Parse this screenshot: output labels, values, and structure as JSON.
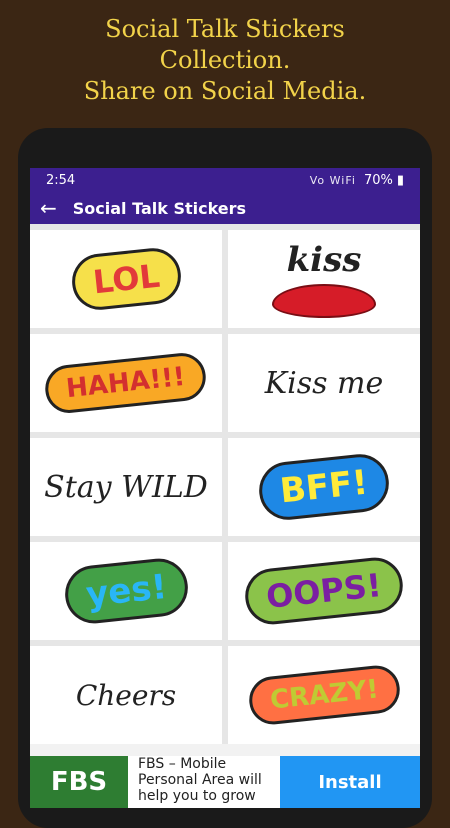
{
  "promo": {
    "line1": "Social Talk Stickers",
    "line2": "Collection.",
    "line3": "Share on Social Media."
  },
  "status": {
    "time": "2:54",
    "signal_icons": "Vo WiFi",
    "battery": "70%"
  },
  "appbar": {
    "title": "Social Talk Stickers"
  },
  "stickers": [
    {
      "text": "LOL"
    },
    {
      "text": "kiss"
    },
    {
      "text": "HAHA!!!"
    },
    {
      "text": "Kiss me"
    },
    {
      "text": "Stay WILD"
    },
    {
      "text": "BFF!"
    },
    {
      "text": "yes!"
    },
    {
      "text": "OOPS!"
    },
    {
      "text": "Cheers"
    },
    {
      "text": "CRAZY!"
    }
  ],
  "ad": {
    "logo": "FBS",
    "text": "FBS – Mobile Personal Area will help you to grow",
    "cta": "Install"
  },
  "colors": {
    "bg": "#3b2614",
    "promo_text": "#f2d34a",
    "appbar": "#3c1f8f"
  }
}
